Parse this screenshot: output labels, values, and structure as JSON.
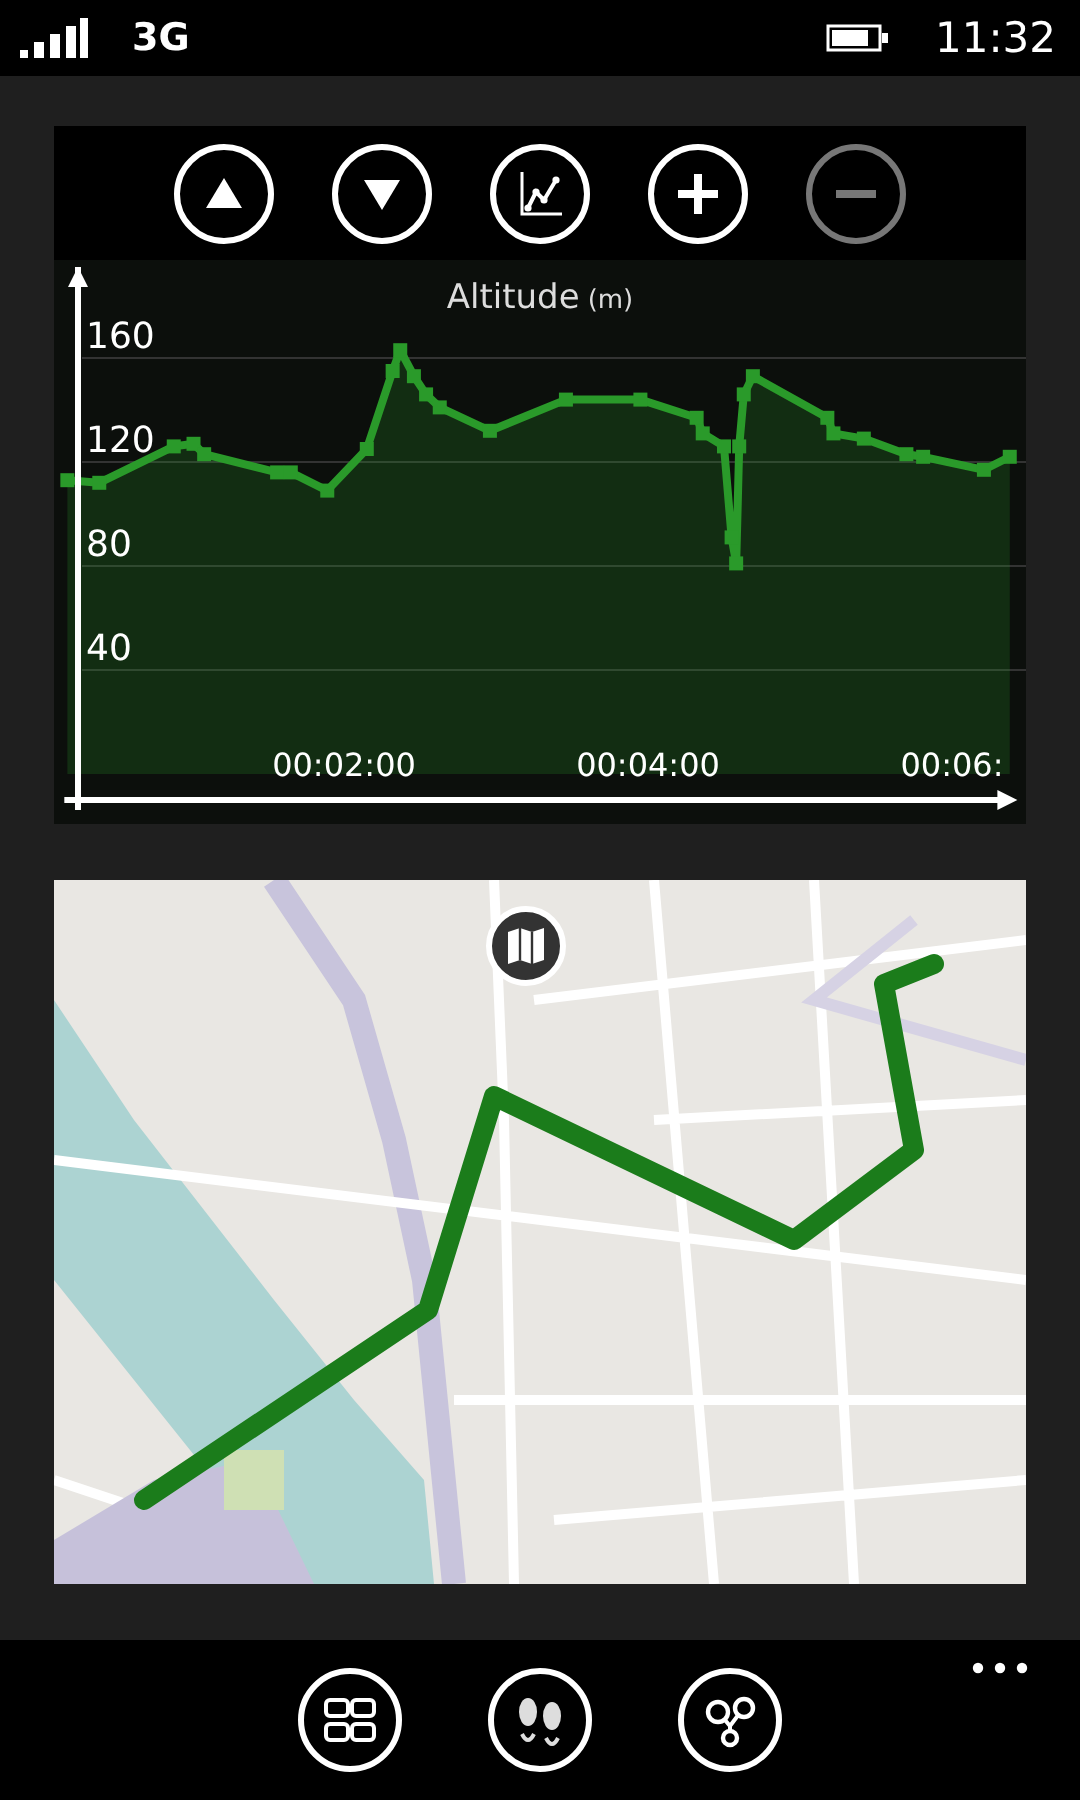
{
  "status_bar": {
    "network": "3G",
    "time": "11:32"
  },
  "toolbar": [
    {
      "kind": "up",
      "disabled": false
    },
    {
      "kind": "down",
      "disabled": false
    },
    {
      "kind": "chart",
      "disabled": false
    },
    {
      "kind": "plus",
      "disabled": false
    },
    {
      "kind": "minus",
      "disabled": true
    }
  ],
  "chart_data": {
    "type": "area",
    "title": "Altitude",
    "ylabel": "(m)",
    "grid": true,
    "xlim": [
      0.16,
      6.43
    ],
    "ylim": [
      -10,
      195
    ],
    "yticks": [
      40,
      80,
      120,
      160
    ],
    "xticks": [
      {
        "value": 2,
        "label": "00:02:00"
      },
      {
        "value": 4,
        "label": "00:04:00"
      },
      {
        "value": 6,
        "label": "00:06:"
      }
    ],
    "x": [
      0.18,
      0.39,
      0.88,
      1.01,
      1.08,
      1.56,
      1.65,
      1.89,
      2.15,
      2.32,
      2.37,
      2.46,
      2.54,
      2.63,
      2.96,
      3.46,
      3.95,
      4.32,
      4.36,
      4.5,
      4.55,
      4.58,
      4.6,
      4.63,
      4.69,
      5.18,
      5.22,
      5.42,
      5.7,
      5.81,
      6.21,
      6.38
    ],
    "series": [
      {
        "color": "#2a9a2a",
        "values": [
          113,
          112,
          126,
          127,
          123,
          116,
          116,
          109,
          125,
          155,
          163,
          153,
          146,
          141,
          132,
          144,
          144,
          137,
          131,
          126,
          91,
          81,
          126,
          146,
          153,
          137,
          131,
          129,
          123,
          122,
          117,
          122
        ]
      }
    ]
  },
  "app_bar": [
    {
      "kind": "tiles"
    },
    {
      "kind": "footprints"
    },
    {
      "kind": "nodes"
    }
  ]
}
